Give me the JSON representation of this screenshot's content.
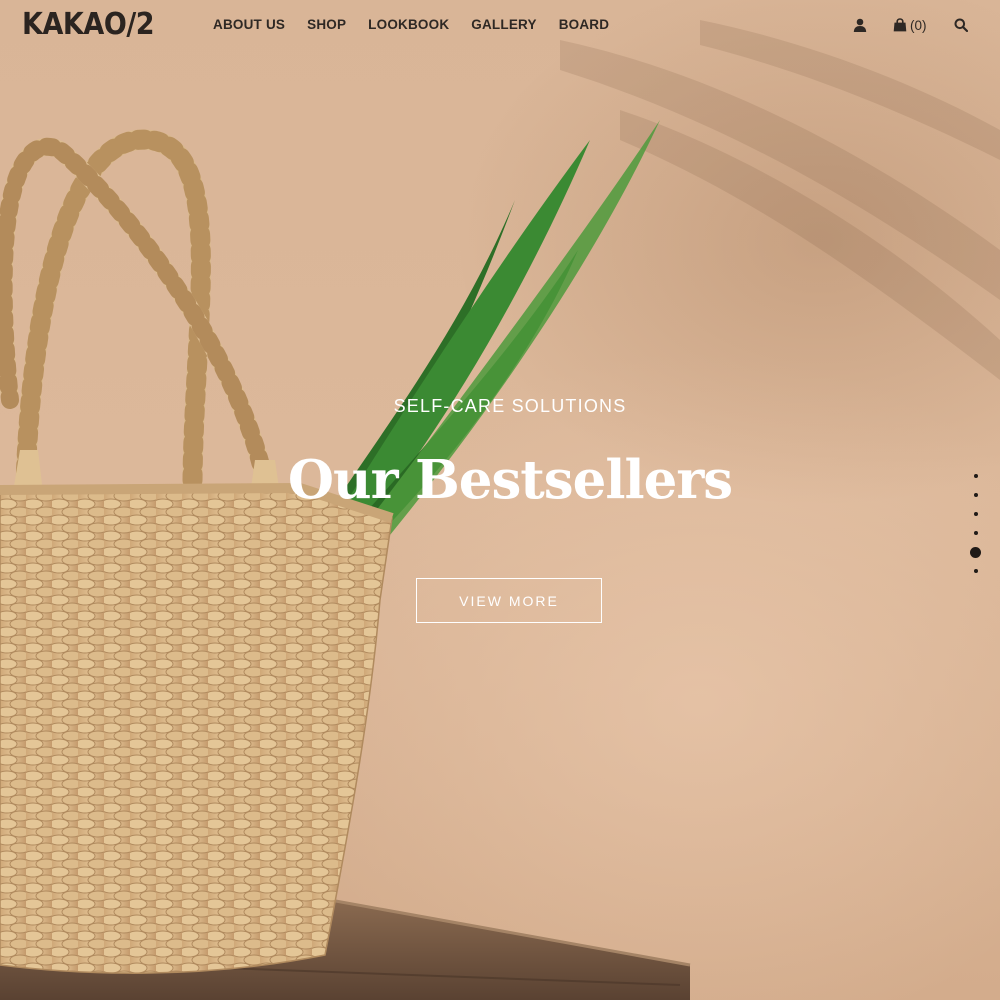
{
  "header": {
    "logo": "KAKAO/2",
    "nav": [
      {
        "label": "ABOUT US"
      },
      {
        "label": "SHOP"
      },
      {
        "label": "LOOKBOOK"
      },
      {
        "label": "GALLERY"
      },
      {
        "label": "BOARD"
      }
    ],
    "icons": {
      "account": "user-icon",
      "cart": "shopping-bag-icon",
      "search": "search-icon"
    },
    "cart_count": "(0)"
  },
  "hero": {
    "kicker": "SELF-CARE SOLUTIONS",
    "headline": "Our Bestsellers",
    "cta_label": "VIEW MORE",
    "slider": {
      "total": 6,
      "active": 5
    }
  },
  "colors": {
    "background": "#d8b497",
    "text_dark": "#2e2824",
    "text_light": "#ffffff",
    "leaf_green": "#2f7a2c",
    "basket_straw": "#d9b98c"
  }
}
